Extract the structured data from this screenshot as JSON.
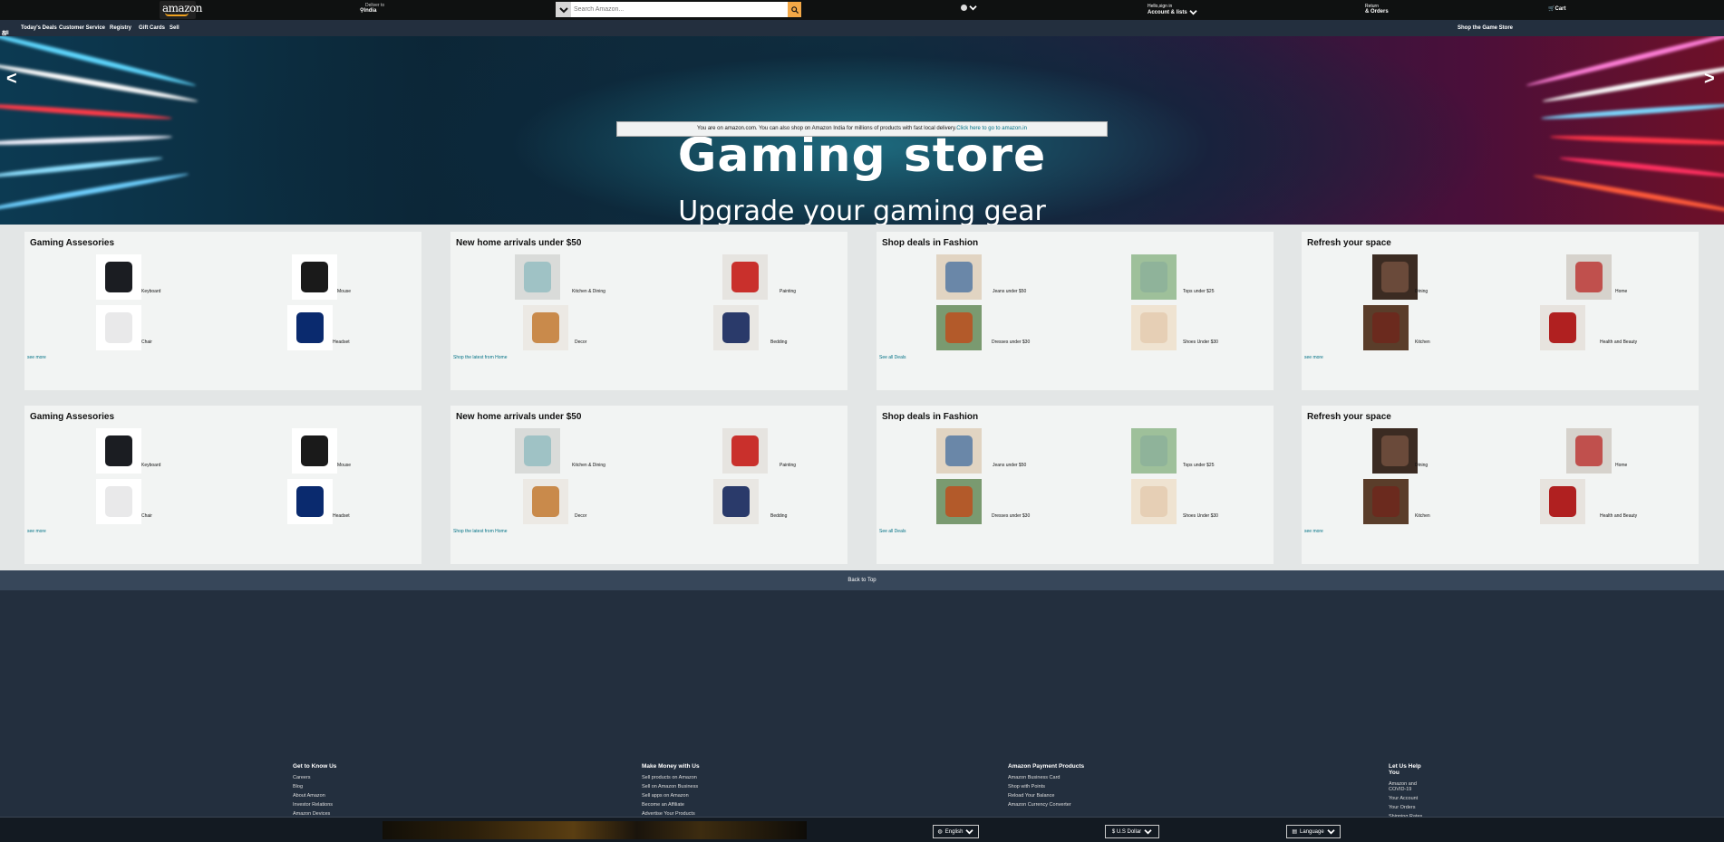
{
  "nav": {
    "logo": "amazon",
    "deliver_label": "Deliver to",
    "deliver_location": "India",
    "search_placeholder": "Search Amazon...",
    "account_line1": "Hello,sign in",
    "account_line2": "Account & lists",
    "returns_line1": "Return",
    "returns_line2": "& Orders",
    "cart": "Cart"
  },
  "subnav": {
    "all": "All",
    "items": [
      "Today's Deals",
      "Customer Service",
      "Registry",
      "Gift Cards",
      "Sell"
    ],
    "promo": "Shop the Game Store"
  },
  "hero": {
    "prev": "<",
    "next": ">",
    "notice_text": "You are on amazon.com. You can also shop on Amazon India for millions of products with fast local delivery.",
    "notice_link": "Click here to go to amazon.in",
    "title": "Gaming store",
    "subtitle": "Upgrade your gaming gear"
  },
  "cards": [
    {
      "title": "Gaming Assesories",
      "link": "see more",
      "items": [
        "Keyboard",
        "Mouse",
        "Chair",
        "Headset"
      ]
    },
    {
      "title": "New home arrivals under $50",
      "link": "Shop the latest from Home",
      "items": [
        "Kitchen & Dining",
        "Painting",
        "Decor",
        "Bedding"
      ]
    },
    {
      "title": "Shop deals in Fashion",
      "link": "See all Deals",
      "items": [
        "Jeans under $50",
        "Tops under $25",
        "Dresses under $30",
        "Shoes Under $30"
      ]
    },
    {
      "title": "Refresh your space",
      "link": "see more",
      "items": [
        "Dining",
        "Home",
        "Kitchen",
        "Health and Beauty"
      ]
    }
  ],
  "back_to_top": "Back to Top",
  "footer": {
    "columns": [
      {
        "title": "Get to Know Us",
        "links": [
          "Careers",
          "Blog",
          "About Amazon",
          "Investor Relations",
          "Amazon Devices"
        ]
      },
      {
        "title": "Make Money with Us",
        "links": [
          "Sell products on Amazon",
          "Sell on Amazon Business",
          "Sell apps on Amazon",
          "Become an Affiliate",
          "Advertise Your Products"
        ]
      },
      {
        "title": "Amazon Payment Products",
        "links": [
          "Amazon Business Card",
          "Shop with Points",
          "Reload Your Balance",
          "Amazon Currency Converter"
        ]
      },
      {
        "title": "Let Us Help You",
        "links": [
          "Amazon and COVID-19",
          "Your Account",
          "Your Orders",
          "Shipping Rates"
        ]
      }
    ],
    "language": "English",
    "currency": "$ U.S Dollar",
    "language2": "Language"
  }
}
